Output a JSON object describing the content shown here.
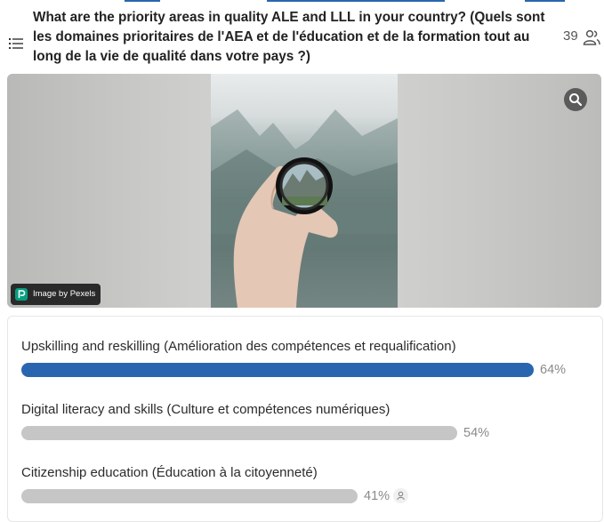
{
  "question": {
    "text": "What are the priority areas in quality ALE and LLL in your country? (Quels sont les domaines prioritaires de l'AEA et de l'éducation et de la formation tout au long de la vie de qualité dans votre pays ?)",
    "participant_count": "39"
  },
  "media": {
    "credit": "Image by Pexels"
  },
  "options": [
    {
      "label": "Upskilling and reskilling (Amélioration des compétences et requalification)",
      "percent_label": "64%",
      "fraction": 0.64,
      "color": "#2a66b0"
    },
    {
      "label": "Digital literacy and skills (Culture et compétences numériques)",
      "percent_label": "54%",
      "fraction": 0.54,
      "color": "#c6c6c6"
    },
    {
      "label": "Citizenship education (Éducation à la citoyenneté)",
      "percent_label": "41%",
      "fraction": 0.41,
      "color": "#c6c6c6"
    }
  ],
  "colors": {
    "accent": "#2a66b0",
    "bar_neutral": "#c6c6c6",
    "credit_logo": "#06a081"
  },
  "icons": [
    "list-icon",
    "users-icon",
    "zoom-icon",
    "pexels-logo-icon",
    "voter-icon"
  ]
}
